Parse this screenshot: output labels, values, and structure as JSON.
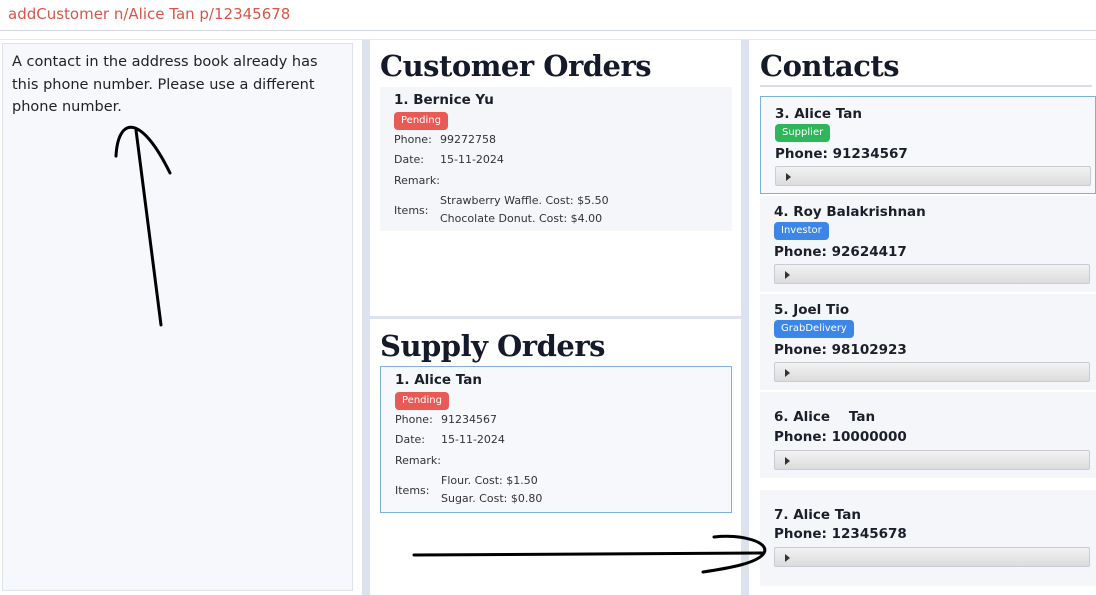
{
  "command": {
    "value": "addCustomer n/Alice Tan p/12345678"
  },
  "result": {
    "message": "A contact in the address book already has this phone number. Please use a different phone number."
  },
  "customer_orders": {
    "title": "Customer Orders",
    "orders": [
      {
        "name": "1. Bernice Yu",
        "status": "Pending",
        "phone_label": "Phone:",
        "phone": "99272758",
        "date_label": "Date:",
        "date": "15-11-2024",
        "remark_label": "Remark:",
        "remark": "",
        "items_label": "Items:",
        "items": [
          "Strawberry Waffle. Cost: $5.50",
          "Chocolate Donut. Cost: $4.00"
        ]
      }
    ]
  },
  "supply_orders": {
    "title": "Supply Orders",
    "orders": [
      {
        "name": "1. Alice Tan",
        "status": "Pending",
        "phone_label": "Phone:",
        "phone": "91234567",
        "date_label": "Date:",
        "date": "15-11-2024",
        "remark_label": "Remark:",
        "remark": "",
        "items_label": "Items:",
        "items": [
          "Flour. Cost: $1.50",
          "Sugar. Cost: $0.80"
        ]
      }
    ]
  },
  "contacts": {
    "title": "Contacts",
    "items": [
      {
        "name": "3. Alice Tan",
        "tag": "Supplier",
        "phone": "Phone: 91234567"
      },
      {
        "name": "4. Roy Balakrishnan",
        "tag": "Investor",
        "phone": "Phone: 92624417"
      },
      {
        "name": "5. Joel Tio",
        "tag": "GrabDelivery",
        "phone": "Phone: 98102923"
      },
      {
        "name": "6. Alice    Tan",
        "tag": "",
        "phone": "Phone: 10000000"
      },
      {
        "name": "7. Alice Tan",
        "tag": "",
        "phone": "Phone: 12345678"
      }
    ]
  },
  "colors": {
    "command_text": "#d9554a",
    "pending_tag": "#e85a55",
    "supplier_tag": "#2fb65a",
    "investor_tag": "#3b86e6",
    "selection_border": "#7fb0d8",
    "annotation_stroke": "#000000"
  },
  "icons": [
    "expand-arrow-icon"
  ]
}
